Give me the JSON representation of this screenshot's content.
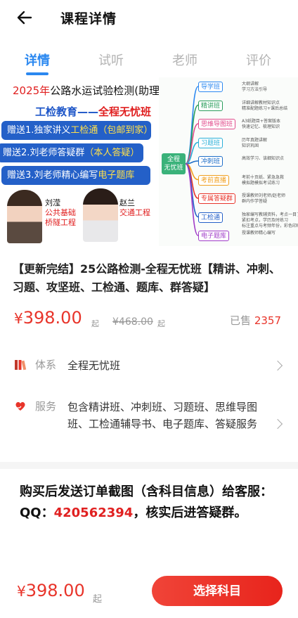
{
  "header": {
    "title": "课程详情"
  },
  "tabs": [
    {
      "label": "详情",
      "active": true
    },
    {
      "label": "试听",
      "active": false
    },
    {
      "label": "老师",
      "active": false
    },
    {
      "label": "评价",
      "active": false
    }
  ],
  "banner": {
    "year": "2025年",
    "headline_rest": "公路水运试验检测(助理)师",
    "subline_a": "工检教育——",
    "subline_b": "全程无忧班",
    "gifts": [
      {
        "pre": "赠送1.独家讲义",
        "hl": "工检通（包邮到家）"
      },
      {
        "pre": "赠送2.刘老师答疑群",
        "hl": "（本人答疑）"
      },
      {
        "pre": "赠送3.刘老师精心编写",
        "hl": "电子题库"
      }
    ],
    "teachers": [
      {
        "name": "刘滢",
        "sub1": "公共基础",
        "sub2": "桥隧工程"
      },
      {
        "name": "赵兰",
        "sub1": "交通工程",
        "sub2": ""
      }
    ],
    "mindmap": {
      "center_a": "全程",
      "center_b": "无忧班",
      "nodes": [
        {
          "label": "导学班",
          "color": "#2b88f0",
          "desc": [
            "大纲讲解",
            "学习方法引导"
          ]
        },
        {
          "label": "精讲班",
          "color": "#2a9d5b",
          "desc": [
            "详细讲解教材知识点",
            "精准配题练习+课后总结"
          ]
        },
        {
          "label": "思维导图班",
          "color": "#e04a8a",
          "desc": [
            "A3纸题目+答案版本",
            "快速记忆、梳理知识"
          ]
        },
        {
          "label": "习题班",
          "color": "#2bb0d8",
          "desc": [
            "历年真题讲解",
            "知识巩固"
          ]
        },
        {
          "label": "冲刺班",
          "color": "#1f6fc8",
          "desc": [
            "高效学习、该细知识点"
          ]
        },
        {
          "label": "考前直播",
          "color": "#f0a020",
          "desc": [
            "考前十页纸、紧急急救",
            "模拟题模拟考试练习"
          ]
        },
        {
          "label": "专属答疑群",
          "color": "#e8342a",
          "desc": [
            "授课教师刘老师/赵老师",
            "群内作学答疑"
          ]
        },
        {
          "label": "工检通",
          "color": "#2460c8",
          "desc": [
            "独家编写教辅资料，考点一目了然",
            "紧扣考点，学历及时练习",
            "标注重点与考频年份，彩色印刷"
          ]
        },
        {
          "label": "电子题库",
          "color": "#a03cc8",
          "desc": [
            "授课教师精心编写"
          ]
        }
      ]
    }
  },
  "course": {
    "title": "【更新完结】25公路检测-全程无忧班【精讲、冲刺、习题、攻坚班、工检通、题库、群答疑】",
    "currency": "¥",
    "price": "398.00",
    "price_suffix": "起",
    "original_price": "¥468.00",
    "original_suffix": "起",
    "sold_label": "已售",
    "sold_count": "2357"
  },
  "info": {
    "system": {
      "label": "体系",
      "value": "全程无忧班"
    },
    "service": {
      "label": "服务",
      "value": "包含精讲班、冲刺班、习题班、思维导图班、工检通辅导书、电子题库、答疑服务"
    }
  },
  "notice": {
    "pre": "购买后发送订单截图（含科目信息）给客服：QQ：",
    "qq": "420562394",
    "post": "，核实后进答疑群。"
  },
  "bottom_bar": {
    "currency": "¥",
    "price": "398.00",
    "price_suffix": "起",
    "button": "选择科目"
  },
  "colors": {
    "accent": "#2b88f0",
    "price": "#e8342a",
    "button": "#f04438"
  }
}
